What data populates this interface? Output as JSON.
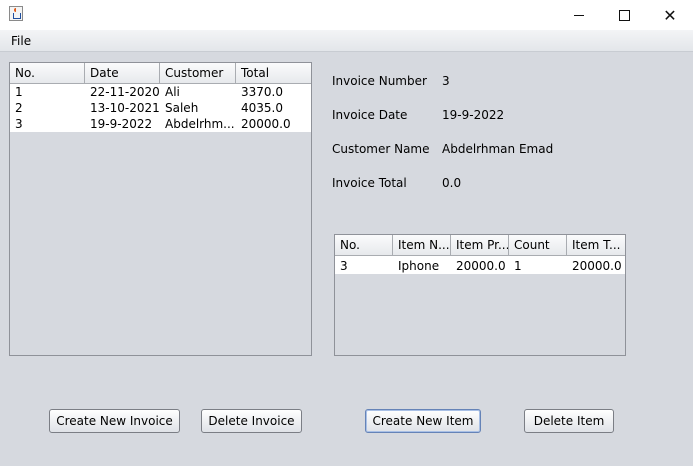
{
  "menubar": {
    "file_label": "File"
  },
  "invoices_table": {
    "columns": [
      "No.",
      "Date",
      "Customer",
      "Total"
    ],
    "rows": [
      [
        "1",
        "22-11-2020",
        "Ali",
        "3370.0"
      ],
      [
        "2",
        "13-10-2021",
        "Saleh",
        "4035.0"
      ],
      [
        "3",
        "19-9-2022",
        "Abdelrhm...",
        "20000.0"
      ]
    ]
  },
  "details": {
    "invoice_number_label": "Invoice Number",
    "invoice_number_value": "3",
    "invoice_date_label": "Invoice Date",
    "invoice_date_value": "19-9-2022",
    "customer_name_label": "Customer Name",
    "customer_name_value": "Abdelrhman Emad",
    "invoice_total_label": "Invoice Total",
    "invoice_total_value": "0.0"
  },
  "items_table": {
    "columns": [
      "No.",
      "Item N...",
      "Item Pr...",
      "Count",
      "Item T..."
    ],
    "rows": [
      [
        "3",
        "Iphone",
        "20000.0",
        "1",
        "20000.0"
      ]
    ]
  },
  "buttons": {
    "create_invoice": "Create New Invoice",
    "delete_invoice": "Delete Invoice",
    "create_item": "Create New Item",
    "delete_item": "Delete Item"
  }
}
